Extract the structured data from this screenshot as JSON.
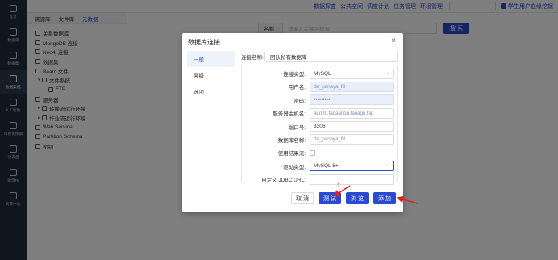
{
  "leftnav": [
    {
      "label": "首页"
    },
    {
      "label": "数据源"
    },
    {
      "label": "数据集"
    },
    {
      "label": "数据集成",
      "active": true
    },
    {
      "label": "人工智能"
    },
    {
      "label": "可视化探索"
    },
    {
      "label": "仪表盘"
    },
    {
      "label": "助理RI"
    },
    {
      "label": "资源中心"
    }
  ],
  "topbar": {
    "links": [
      "数据探查",
      "公共空间",
      "调度计划",
      "任务管理",
      "环境管理"
    ],
    "user": "学生用户血缘挖掘"
  },
  "tree_tabs": [
    "资源库",
    "文件库",
    "元数据"
  ],
  "tree": [
    {
      "label": "关系数据库",
      "caret": ""
    },
    {
      "label": "MongoDB 连接",
      "caret": ""
    },
    {
      "label": "Neo4j 连接",
      "caret": ""
    },
    {
      "label": "数据集",
      "caret": ""
    },
    {
      "label": "Beam 文件",
      "caret": ""
    },
    {
      "label": "文件系统",
      "caret": "▾"
    },
    {
      "label": "FTP",
      "caret": ""
    },
    {
      "label": "服务器",
      "caret": ""
    },
    {
      "label": "转换流运行环境",
      "caret": "▸"
    },
    {
      "label": "作业流运行环境",
      "caret": "▸"
    },
    {
      "label": "Web Service",
      "caret": ""
    },
    {
      "label": "Partition Schema",
      "caret": ""
    },
    {
      "label": "密钥",
      "caret": ""
    }
  ],
  "search": {
    "prefix": "名称",
    "placeholder": "请输入关键字搜索",
    "button": "搜 索"
  },
  "dialog": {
    "title": "数据库连接",
    "close": "×",
    "side": [
      "一般",
      "高级",
      "选项"
    ],
    "conn_label": "连接名称:",
    "conn_value": "团队私有数据库",
    "fields": [
      {
        "label": "连接类型:",
        "value": "MySQL",
        "required": true,
        "select": true
      },
      {
        "label": "用户名:",
        "value": "da_panaya_fill",
        "style": "filled blurred"
      },
      {
        "label": "密码:",
        "value": "•••••••••",
        "style": "filled"
      },
      {
        "label": "服务器主机名:",
        "value": "aun.fu.fapaanqu.fanagu.fap",
        "style": "blurred"
      },
      {
        "label": "端口号:",
        "value": "3306"
      },
      {
        "label": "数据库名称:",
        "value": "da_panaya_fill",
        "style": "blurred"
      },
      {
        "label": "使用结果流:",
        "checkbox": true
      },
      {
        "label": "驱动类型:",
        "value": "MySQL 8+",
        "required": true,
        "select": true,
        "style": "focus"
      },
      {
        "label": "自定义 JDBC URL:",
        "value": ""
      }
    ],
    "buttons": {
      "cancel": "取 消",
      "test": "测 试",
      "browse": "浏 览",
      "add": "添 加"
    },
    "annotation": "1"
  }
}
